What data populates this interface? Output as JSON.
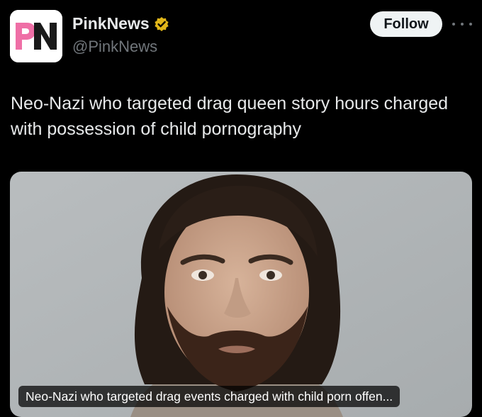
{
  "account": {
    "display_name": "PinkNews",
    "handle": "@PinkNews",
    "avatar_text": "PN",
    "verified_icon": "verified-badge-icon",
    "badge_color": "#e2b719"
  },
  "actions": {
    "follow_label": "Follow",
    "more_icon": "more-options-icon"
  },
  "tweet": {
    "text": "Neo-Nazi who targeted drag queen story hours charged with possession of child pornography"
  },
  "media": {
    "caption": "Neo-Nazi who targeted drag events charged with child porn offen..."
  },
  "colors": {
    "background": "#000000",
    "text_primary": "#e7e9ea",
    "text_secondary": "#71767b",
    "brand_pink": "#ef6fa6",
    "brand_dark": "#1a1a1a"
  }
}
